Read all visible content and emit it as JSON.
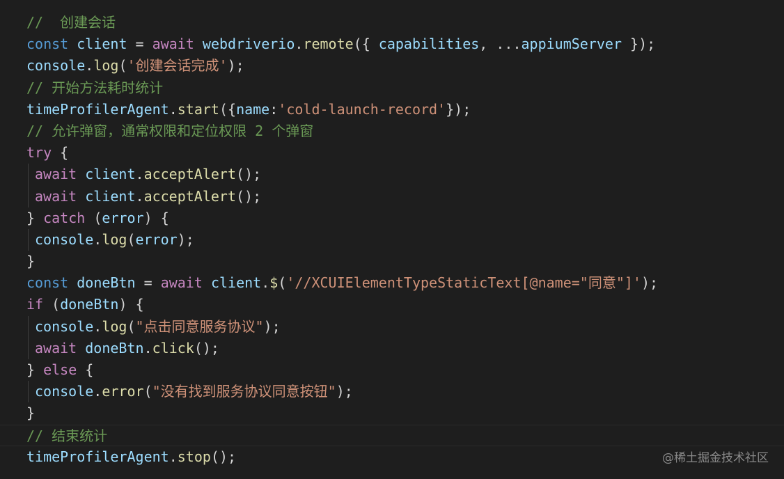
{
  "lines": [
    [
      {
        "t": "cm",
        "v": "//  创建会话"
      }
    ],
    [
      {
        "t": "k",
        "v": "const"
      },
      {
        "t": "p",
        "v": " "
      },
      {
        "t": "v",
        "v": "client"
      },
      {
        "t": "p",
        "v": " = "
      },
      {
        "t": "c",
        "v": "await"
      },
      {
        "t": "p",
        "v": " "
      },
      {
        "t": "v",
        "v": "webdriverio"
      },
      {
        "t": "p",
        "v": "."
      },
      {
        "t": "f",
        "v": "remote"
      },
      {
        "t": "p",
        "v": "({ "
      },
      {
        "t": "v",
        "v": "capabilities"
      },
      {
        "t": "p",
        "v": ", ..."
      },
      {
        "t": "v",
        "v": "appiumServer"
      },
      {
        "t": "p",
        "v": " });"
      }
    ],
    [
      {
        "t": "v",
        "v": "console"
      },
      {
        "t": "p",
        "v": "."
      },
      {
        "t": "f",
        "v": "log"
      },
      {
        "t": "p",
        "v": "("
      },
      {
        "t": "s",
        "v": "'创建会话完成'"
      },
      {
        "t": "p",
        "v": ");"
      }
    ],
    [
      {
        "t": "cm",
        "v": "// 开始方法耗时统计"
      }
    ],
    [
      {
        "t": "v",
        "v": "timeProfilerAgent"
      },
      {
        "t": "p",
        "v": "."
      },
      {
        "t": "f",
        "v": "start"
      },
      {
        "t": "p",
        "v": "({"
      },
      {
        "t": "v",
        "v": "name"
      },
      {
        "t": "p",
        "v": ":"
      },
      {
        "t": "s",
        "v": "'cold-launch-record'"
      },
      {
        "t": "p",
        "v": "});"
      }
    ],
    [
      {
        "t": "cm",
        "v": "// 允许弹窗，通常权限和定位权限 2 个弹窗"
      }
    ],
    [
      {
        "t": "c",
        "v": "try"
      },
      {
        "t": "p",
        "v": " {"
      }
    ],
    [
      {
        "t": "c",
        "v": "await"
      },
      {
        "t": "p",
        "v": " "
      },
      {
        "t": "v",
        "v": "client"
      },
      {
        "t": "p",
        "v": "."
      },
      {
        "t": "f",
        "v": "acceptAlert"
      },
      {
        "t": "p",
        "v": "();"
      }
    ],
    [
      {
        "t": "c",
        "v": "await"
      },
      {
        "t": "p",
        "v": " "
      },
      {
        "t": "v",
        "v": "client"
      },
      {
        "t": "p",
        "v": "."
      },
      {
        "t": "f",
        "v": "acceptAlert"
      },
      {
        "t": "p",
        "v": "();"
      }
    ],
    [
      {
        "t": "p",
        "v": "} "
      },
      {
        "t": "c",
        "v": "catch"
      },
      {
        "t": "p",
        "v": " ("
      },
      {
        "t": "v",
        "v": "error"
      },
      {
        "t": "p",
        "v": ") {"
      }
    ],
    [
      {
        "t": "v",
        "v": "console"
      },
      {
        "t": "p",
        "v": "."
      },
      {
        "t": "f",
        "v": "log"
      },
      {
        "t": "p",
        "v": "("
      },
      {
        "t": "v",
        "v": "error"
      },
      {
        "t": "p",
        "v": ");"
      }
    ],
    [
      {
        "t": "p",
        "v": "}"
      }
    ],
    [
      {
        "t": "k",
        "v": "const"
      },
      {
        "t": "p",
        "v": " "
      },
      {
        "t": "v",
        "v": "doneBtn"
      },
      {
        "t": "p",
        "v": " = "
      },
      {
        "t": "c",
        "v": "await"
      },
      {
        "t": "p",
        "v": " "
      },
      {
        "t": "v",
        "v": "client"
      },
      {
        "t": "p",
        "v": "."
      },
      {
        "t": "f",
        "v": "$"
      },
      {
        "t": "p",
        "v": "("
      },
      {
        "t": "s",
        "v": "'//XCUIElementTypeStaticText[@name=\"同意\"]'"
      },
      {
        "t": "p",
        "v": ");"
      }
    ],
    [
      {
        "t": "c",
        "v": "if"
      },
      {
        "t": "p",
        "v": " ("
      },
      {
        "t": "v",
        "v": "doneBtn"
      },
      {
        "t": "p",
        "v": ") {"
      }
    ],
    [
      {
        "t": "v",
        "v": "console"
      },
      {
        "t": "p",
        "v": "."
      },
      {
        "t": "f",
        "v": "log"
      },
      {
        "t": "p",
        "v": "("
      },
      {
        "t": "s",
        "v": "\"点击同意服务协议\""
      },
      {
        "t": "p",
        "v": ");"
      }
    ],
    [
      {
        "t": "c",
        "v": "await"
      },
      {
        "t": "p",
        "v": " "
      },
      {
        "t": "v",
        "v": "doneBtn"
      },
      {
        "t": "p",
        "v": "."
      },
      {
        "t": "f",
        "v": "click"
      },
      {
        "t": "p",
        "v": "();"
      }
    ],
    [
      {
        "t": "p",
        "v": "} "
      },
      {
        "t": "c",
        "v": "else"
      },
      {
        "t": "p",
        "v": " {"
      }
    ],
    [
      {
        "t": "v",
        "v": "console"
      },
      {
        "t": "p",
        "v": "."
      },
      {
        "t": "f",
        "v": "error"
      },
      {
        "t": "p",
        "v": "("
      },
      {
        "t": "s",
        "v": "\"没有找到服务协议同意按钮\""
      },
      {
        "t": "p",
        "v": ");"
      }
    ],
    [
      {
        "t": "p",
        "v": "}"
      }
    ],
    [
      {
        "t": "cm",
        "v": "// 结束统计"
      }
    ],
    [
      {
        "t": "v",
        "v": "timeProfilerAgent"
      },
      {
        "t": "p",
        "v": "."
      },
      {
        "t": "f",
        "v": "stop"
      },
      {
        "t": "p",
        "v": "();"
      }
    ]
  ],
  "watermark": "@稀土掘金技术社区"
}
